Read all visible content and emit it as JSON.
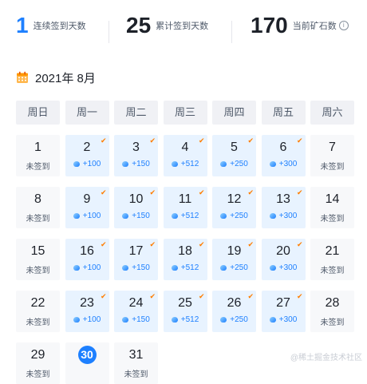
{
  "stats": {
    "consecutive": {
      "value": "1",
      "label": "连续签到天数"
    },
    "total": {
      "value": "25",
      "label": "累计签到天数"
    },
    "ore": {
      "value": "170",
      "label": "当前矿石数",
      "info_icon": "info-icon"
    }
  },
  "calendar": {
    "title": "2021年 8月",
    "icon": "calendar-icon",
    "weekdays": [
      "周日",
      "周一",
      "周二",
      "周三",
      "周四",
      "周五",
      "周六"
    ],
    "unsigned_label": "未签到",
    "weeks": [
      [
        {
          "day": "1",
          "signed": false
        },
        {
          "day": "2",
          "signed": true,
          "reward": "+100"
        },
        {
          "day": "3",
          "signed": true,
          "reward": "+150"
        },
        {
          "day": "4",
          "signed": true,
          "reward": "+512"
        },
        {
          "day": "5",
          "signed": true,
          "reward": "+250"
        },
        {
          "day": "6",
          "signed": true,
          "reward": "+300"
        },
        {
          "day": "7",
          "signed": false
        }
      ],
      [
        {
          "day": "8",
          "signed": false
        },
        {
          "day": "9",
          "signed": true,
          "reward": "+100"
        },
        {
          "day": "10",
          "signed": true,
          "reward": "+150"
        },
        {
          "day": "11",
          "signed": true,
          "reward": "+512"
        },
        {
          "day": "12",
          "signed": true,
          "reward": "+250"
        },
        {
          "day": "13",
          "signed": true,
          "reward": "+300"
        },
        {
          "day": "14",
          "signed": false
        }
      ],
      [
        {
          "day": "15",
          "signed": false
        },
        {
          "day": "16",
          "signed": true,
          "reward": "+100"
        },
        {
          "day": "17",
          "signed": true,
          "reward": "+150"
        },
        {
          "day": "18",
          "signed": true,
          "reward": "+512"
        },
        {
          "day": "19",
          "signed": true,
          "reward": "+250"
        },
        {
          "day": "20",
          "signed": true,
          "reward": "+300"
        },
        {
          "day": "21",
          "signed": false
        }
      ],
      [
        {
          "day": "22",
          "signed": false
        },
        {
          "day": "23",
          "signed": true,
          "reward": "+100"
        },
        {
          "day": "24",
          "signed": true,
          "reward": "+150"
        },
        {
          "day": "25",
          "signed": true,
          "reward": "+512"
        },
        {
          "day": "26",
          "signed": true,
          "reward": "+250"
        },
        {
          "day": "27",
          "signed": true,
          "reward": "+300"
        },
        {
          "day": "28",
          "signed": false
        }
      ],
      [
        {
          "day": "29",
          "signed": false
        },
        {
          "day": "30",
          "signed": false,
          "today": true
        },
        {
          "day": "31",
          "signed": false
        }
      ]
    ]
  },
  "colors": {
    "accent": "#1e80ff",
    "check": "#ff7d00",
    "signed_bg": "#e8f3ff",
    "unsigned_bg": "#f7f8fa"
  },
  "watermark": "@稀土掘金技术社区"
}
